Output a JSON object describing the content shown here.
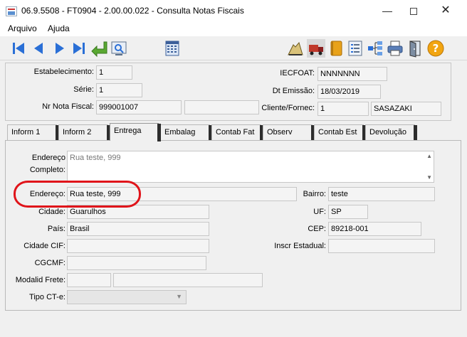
{
  "window": {
    "title": "06.9.5508 - FT0904 - 2.00.00.022 - Consulta Notas Fiscais",
    "minimize": "—",
    "close": "✕"
  },
  "menu": [
    "Arquivo",
    "Ajuda"
  ],
  "header": {
    "estabelecimento_label": "Estabelecimento:",
    "estabelecimento_value": "1",
    "serie_label": "Série:",
    "serie_value": "1",
    "nr_nota_label": "Nr Nota Fiscal:",
    "nr_nota_value": "999001007",
    "nr_nota_extra": "",
    "iecfoat_label": "IECFOAT:",
    "iecfoat_value": "NNNNNNN",
    "dt_emissao_label": "Dt Emissão:",
    "dt_emissao_value": "18/03/2019",
    "cliente_label": "Cliente/Fornec:",
    "cliente_code": "1",
    "cliente_name": "SASAZAKI"
  },
  "tabs": [
    "Inform 1",
    "Inform 2",
    "Entrega",
    "Embalag",
    "Contab Fat",
    "Observ",
    "Contab Est",
    "Devolução"
  ],
  "selected_tab": "Entrega",
  "entrega": {
    "endereco_completo_label_1": "Endereço",
    "endereco_completo_label_2": "Completo:",
    "endereco_completo_value": "Rua teste, 999",
    "endereco_label": "Endereço:",
    "endereco_value": "Rua teste, 999",
    "bairro_label": "Bairro:",
    "bairro_value": "teste",
    "cidade_label": "Cidade:",
    "cidade_value": "Guarulhos",
    "uf_label": "UF:",
    "uf_value": "SP",
    "pais_label": "País:",
    "pais_value": "Brasil",
    "cep_label": "CEP:",
    "cep_value": "89218-001",
    "cidade_cif_label": "Cidade CIF:",
    "cidade_cif_value": "",
    "inscr_estadual_label": "Inscr Estadual:",
    "inscr_estadual_value": "",
    "cgcmf_label": "CGCMF:",
    "cgcmf_value": "",
    "modalid_frete_label": "Modalid Frete:",
    "modalid_frete_value": "",
    "modalid_frete_desc": "",
    "tipo_cte_label": "Tipo CT-e:",
    "tipo_cte_value": ""
  },
  "colors": {
    "highlight": "#e0141a",
    "nav_blue": "#2a6fd6"
  }
}
